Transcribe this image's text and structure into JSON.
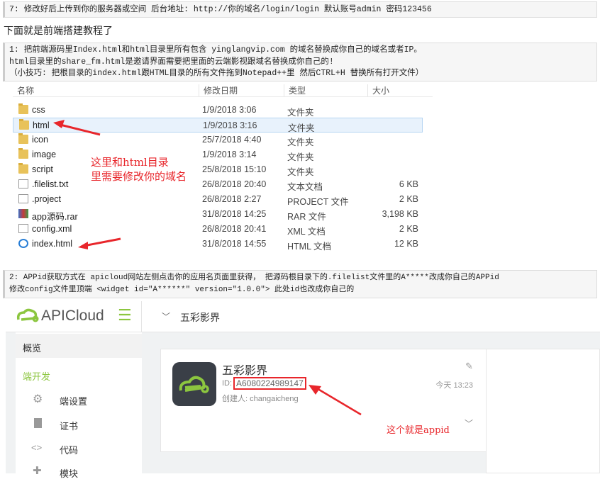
{
  "step7": "7: 修改好后上传到你的服务器或空间 后台地址: http://你的域名/login/login  默认账号admin 密码123456",
  "intro": "下面就是前端搭建教程了",
  "step1": {
    "line1": "1: 把前端源码里Index.html和html目录里所有包含  yinglangvip.com    的域名替换成你自己的域名或者IP。",
    "line2": "html目录里的share_fm.html是邀请界面需要把里面的云端影视跟域名替换成你自己的!",
    "line3": "（小技巧: 把根目录的index.html跟HTML目录的所有文件拖到Notepad++里 然后CTRL+H 替换所有打开文件）"
  },
  "explorer": {
    "headers": [
      "名称",
      "修改日期",
      "类型",
      "大小"
    ],
    "rows": [
      {
        "name": "css",
        "date": "1/9/2018 3:06",
        "type": "文件夹",
        "size": "",
        "icon": "folder"
      },
      {
        "name": "html",
        "date": "1/9/2018 3:16",
        "type": "文件夹",
        "size": "",
        "icon": "folder"
      },
      {
        "name": "icon",
        "date": "25/7/2018 4:40",
        "type": "文件夹",
        "size": "",
        "icon": "folder"
      },
      {
        "name": "image",
        "date": "1/9/2018 3:14",
        "type": "文件夹",
        "size": "",
        "icon": "folder"
      },
      {
        "name": "script",
        "date": "25/8/2018 15:10",
        "type": "文件夹",
        "size": "",
        "icon": "folder"
      },
      {
        "name": ".filelist.txt",
        "date": "26/8/2018 20:40",
        "type": "文本文档",
        "size": "6 KB",
        "icon": "file"
      },
      {
        "name": ".project",
        "date": "26/8/2018 2:27",
        "type": "PROJECT 文件",
        "size": "2 KB",
        "icon": "file"
      },
      {
        "name": "app源码.rar",
        "date": "31/8/2018 14:25",
        "type": "RAR 文件",
        "size": "3,198 KB",
        "icon": "rar"
      },
      {
        "name": "config.xml",
        "date": "26/8/2018 20:41",
        "type": "XML 文档",
        "size": "2 KB",
        "icon": "file"
      },
      {
        "name": "index.html",
        "date": "31/8/2018 14:55",
        "type": "HTML 文档",
        "size": "12 KB",
        "icon": "ie"
      }
    ],
    "annotation1": "这里和html目录",
    "annotation2": "里需要修改你的域名"
  },
  "step2": {
    "line1": "2: APPid获取方式在 apicloud网站左侧点击你的应用名页面里获得，  把源码根目录下的.filelist文件里的A*****改成你自己的APPid",
    "line2": "修改config文件里顶端 <widget id=\"A******\"  version=\"1.0.0\">  此处id也改成你自己的"
  },
  "apicloud": {
    "logo": "APICloud",
    "breadcrumb": "五彩影界",
    "side": [
      "概览",
      "端开发",
      "端设置",
      "证书",
      "代码",
      "模块"
    ],
    "app_name": "五彩影界",
    "id_label": "ID:",
    "app_id": "A6080224989147",
    "creator": "创建人: changaicheng",
    "time": "今天 13:23",
    "annotation": "这个就是appid",
    "colors": {
      "brand": "#8cc63f",
      "red": "#e8262b"
    }
  }
}
